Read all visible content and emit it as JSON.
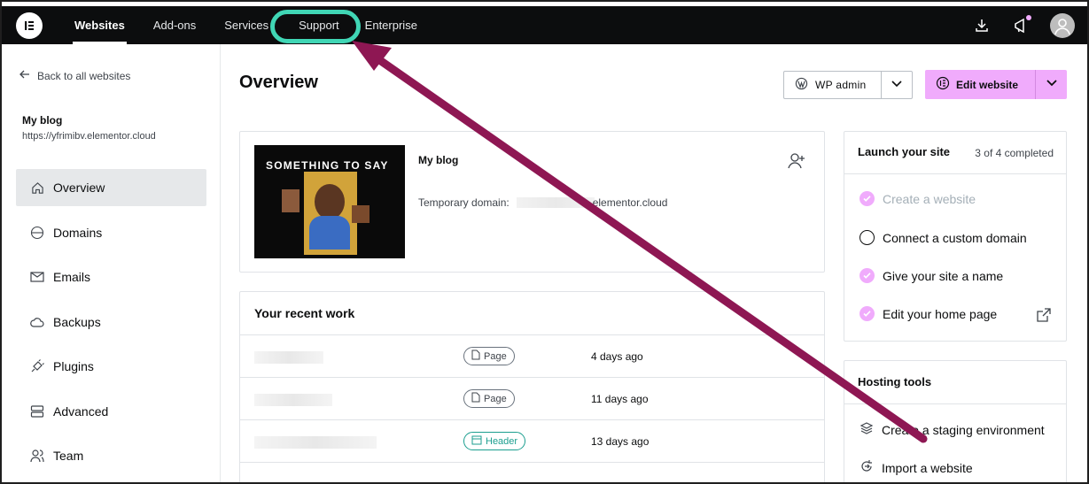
{
  "topnav": {
    "tabs": [
      {
        "label": "Websites",
        "active": true
      },
      {
        "label": "Add-ons",
        "active": false
      },
      {
        "label": "Services",
        "active": false
      },
      {
        "label": "Support",
        "active": false
      },
      {
        "label": "Enterprise",
        "active": false
      }
    ],
    "highlight_color": "#40d6b5",
    "icons": [
      "download-icon",
      "megaphone-icon",
      "user-avatar-icon"
    ]
  },
  "sidebar": {
    "back_label": "Back to all websites",
    "site_name": "My blog",
    "site_url": "https://yfrimibv.elementor.cloud",
    "items": [
      {
        "label": "Overview",
        "icon": "home-icon",
        "active": true
      },
      {
        "label": "Domains",
        "icon": "www-globe-icon",
        "active": false
      },
      {
        "label": "Emails",
        "icon": "mail-icon",
        "active": false
      },
      {
        "label": "Backups",
        "icon": "cloud-icon",
        "active": false
      },
      {
        "label": "Plugins",
        "icon": "plug-icon",
        "active": false
      },
      {
        "label": "Advanced",
        "icon": "server-icon",
        "active": false
      },
      {
        "label": "Team",
        "icon": "team-icon",
        "active": false
      }
    ]
  },
  "main": {
    "title": "Overview",
    "wp_admin_label": "WP admin",
    "edit_website_label": "Edit website",
    "accent_color": "#f0abfc",
    "site_card": {
      "thumbnail_headline": "SOMETHING TO SAY",
      "blog_title": "My blog",
      "temp_domain_label": "Temporary domain:",
      "temp_domain_suffix": "elementor.cloud"
    },
    "recent_work": {
      "title": "Your recent work",
      "rows": [
        {
          "type": "Page",
          "when": "4 days ago"
        },
        {
          "type": "Page",
          "when": "11 days ago"
        },
        {
          "type": "Header",
          "when": "13 days ago"
        }
      ]
    },
    "launch": {
      "title": "Launch your site",
      "progress": "3 of 4 completed",
      "tasks": [
        {
          "label": "Create a website",
          "done": true
        },
        {
          "label": "Connect a custom domain",
          "done": false
        },
        {
          "label": "Give your site a name",
          "done": true
        },
        {
          "label": "Edit your home page",
          "done": true
        }
      ]
    },
    "hosting": {
      "title": "Hosting tools",
      "tools": [
        {
          "label": "Create a staging environment",
          "icon": "layers-icon"
        },
        {
          "label": "Import a website",
          "icon": "import-icon"
        }
      ]
    }
  },
  "annotation_color": "#8e1753"
}
